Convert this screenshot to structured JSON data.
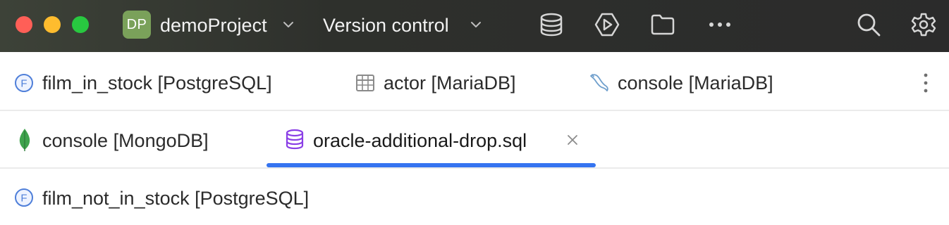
{
  "titlebar": {
    "project_badge": "DP",
    "project_name": "demoProject",
    "vcs_label": "Version control",
    "icons": [
      "database-icon",
      "run-icon",
      "folder-icon",
      "more-icon",
      "search-icon",
      "settings-icon"
    ]
  },
  "tabs": {
    "row1": [
      {
        "label": "film_in_stock [PostgreSQL]",
        "icon": "function-icon"
      },
      {
        "label": "actor [MariaDB]",
        "icon": "table-icon"
      },
      {
        "label": "console [MariaDB]",
        "icon": "mariadb-icon"
      }
    ],
    "row2": [
      {
        "label": "console [MongoDB]",
        "icon": "mongodb-icon"
      },
      {
        "label": "oracle-additional-drop.sql",
        "icon": "sql-file-icon",
        "active": true
      }
    ],
    "row3": [
      {
        "label": "film_not_in_stock [PostgreSQL]",
        "icon": "function-icon"
      }
    ]
  },
  "colors": {
    "titlebar": "#2b2b2b",
    "accent": "#3574f0",
    "project_badge": "#7aa15a",
    "sql_icon": "#8a3ee6",
    "mongo_icon": "#3fa34d"
  }
}
